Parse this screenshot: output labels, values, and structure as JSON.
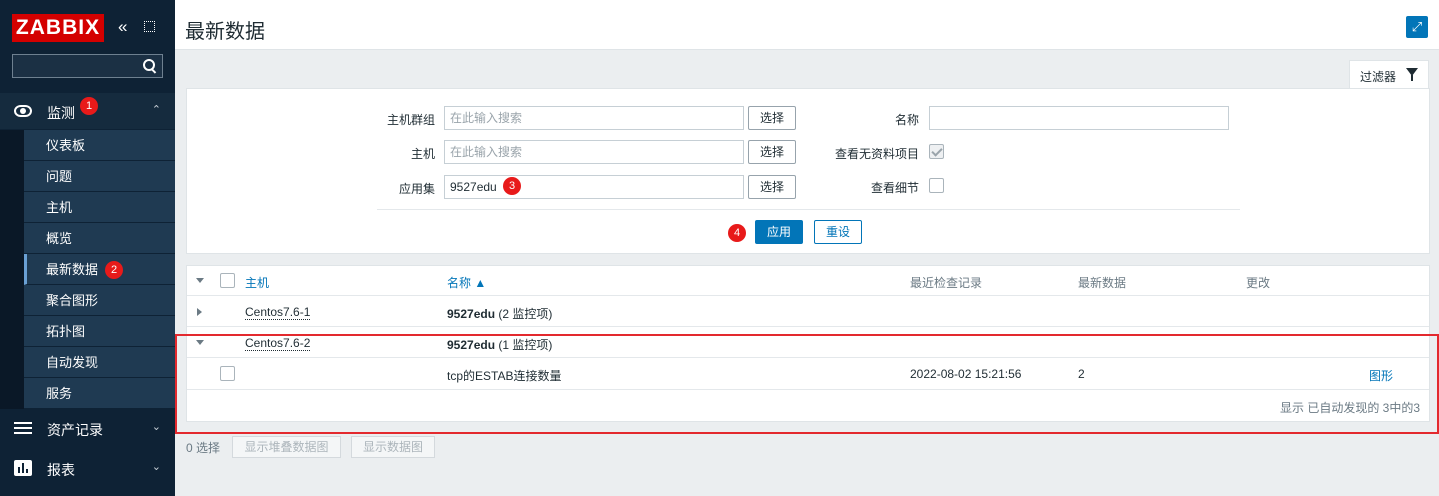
{
  "sidebar": {
    "logo": "ZABBIX",
    "sections": {
      "monitor": {
        "label": "监测",
        "badge": "1"
      },
      "assets": {
        "label": "资产记录"
      },
      "reports": {
        "label": "报表"
      }
    },
    "submenu": [
      {
        "label": "仪表板"
      },
      {
        "label": "问题"
      },
      {
        "label": "主机"
      },
      {
        "label": "概览"
      },
      {
        "label": "最新数据",
        "badge": "2"
      },
      {
        "label": "聚合图形"
      },
      {
        "label": "拓扑图"
      },
      {
        "label": "自动发现"
      },
      {
        "label": "服务"
      }
    ]
  },
  "header": {
    "title": "最新数据"
  },
  "filter": {
    "tab_label": "过滤器",
    "host_group_label": "主机群组",
    "host_group_placeholder": "在此输入搜索",
    "host_label": "主机",
    "host_placeholder": "在此输入搜索",
    "application_label": "应用集",
    "application_value": "9527edu",
    "application_badge": "3",
    "select_label": "选择",
    "name_label": "名称",
    "name_value": "",
    "show_no_data_label": "查看无资料项目",
    "show_details_label": "查看细节",
    "apply_badge": "4",
    "apply_label": "应用",
    "reset_label": "重设"
  },
  "table": {
    "headers": {
      "host": "主机",
      "name": "名称 ▲",
      "last_check": "最近检查记录",
      "last_value": "最新数据",
      "change": "更改"
    },
    "groups": [
      {
        "host": "Centos7.6-1",
        "app": "9527edu",
        "count": "(2 监控项)"
      },
      {
        "host": "Centos7.6-2",
        "app": "9527edu",
        "count": "(1 监控项)"
      }
    ],
    "item": {
      "name": "tcp的ESTAB连接数量",
      "last_check": "2022-08-02 15:21:56",
      "last_value": "2",
      "graph_link": "图形"
    },
    "footer": "显示 已自动发现的 3中的3"
  },
  "bottom": {
    "selected": "0 选择",
    "stacked_graph": "显示堆叠数据图",
    "graph": "显示数据图"
  },
  "colors": {
    "accent": "#0275b8",
    "sidebar_bg": "#0e2235",
    "logo_red": "#d40000",
    "annotation_red": "#e3292e"
  }
}
